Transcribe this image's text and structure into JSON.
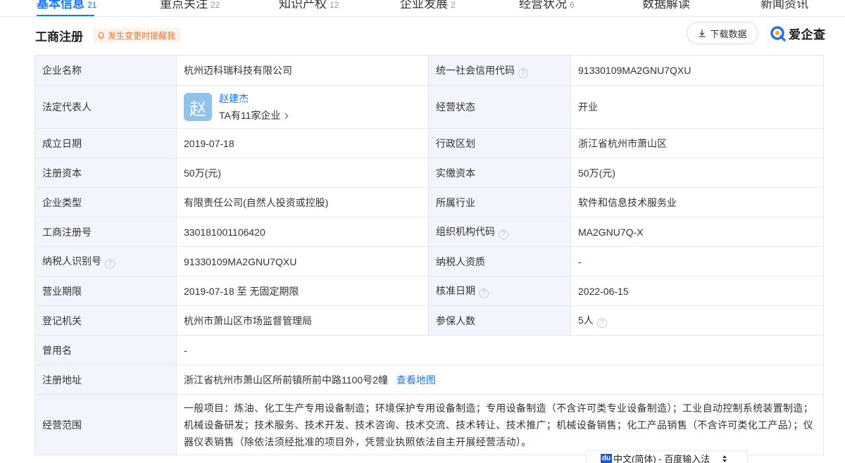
{
  "tabs": [
    {
      "label": "基本信息",
      "count": "21",
      "active": true
    },
    {
      "label": "重点关注",
      "count": "22"
    },
    {
      "label": "知识产权",
      "count": "12"
    },
    {
      "label": "企业发展",
      "count": "2"
    },
    {
      "label": "经营状况",
      "count": "6"
    },
    {
      "label": "数据解读",
      "count": ""
    },
    {
      "label": "新闻资讯",
      "count": ""
    }
  ],
  "section": {
    "title": "工商注册",
    "remind_label": "发生变更时提醒我",
    "download_label": "下载数据",
    "brand": "爱企查",
    "brand_color": "#2a6ff0"
  },
  "rows": {
    "company_name": {
      "label": "企业名称",
      "value": "杭州迈科瑞科技有限公司"
    },
    "credit_code": {
      "label": "统一社会信用代码",
      "value": "91330109MA2GNU7QXU"
    },
    "legal_rep": {
      "label": "法定代表人",
      "avatar": "赵",
      "name": "赵建杰",
      "sub": "TA有11家企业"
    },
    "status": {
      "label": "经营状态",
      "value": "开业"
    },
    "founded": {
      "label": "成立日期",
      "value": "2019-07-18"
    },
    "region": {
      "label": "行政区划",
      "value": "浙江省杭州市萧山区"
    },
    "reg_capital": {
      "label": "注册资本",
      "value": "50万(元)"
    },
    "paid_capital": {
      "label": "实缴资本",
      "value": "50万(元)"
    },
    "company_type": {
      "label": "企业类型",
      "value": "有限责任公司(自然人投资或控股)"
    },
    "industry": {
      "label": "所属行业",
      "value": "软件和信息技术服务业"
    },
    "reg_no": {
      "label": "工商注册号",
      "value": "330181001106420"
    },
    "org_code": {
      "label": "组织机构代码",
      "value": "MA2GNU7Q-X"
    },
    "tax_id": {
      "label": "纳税人识别号",
      "value": "91330109MA2GNU7QXU"
    },
    "taxpayer_quali": {
      "label": "纳税人资质",
      "value": "-"
    },
    "term": {
      "label": "营业期限",
      "value": "2019-07-18 至 无固定期限"
    },
    "approval_date": {
      "label": "核准日期",
      "value": "2022-06-15"
    },
    "authority": {
      "label": "登记机关",
      "value": "杭州市萧山区市场监督管理局"
    },
    "insured": {
      "label": "参保人数",
      "value": "5人"
    },
    "former_name": {
      "label": "曾用名",
      "value": "-"
    },
    "address": {
      "label": "注册地址",
      "value": "浙江省杭州市萧山区所前镇所前中路1100号2幢",
      "map_link": "查看地图"
    },
    "scope": {
      "label": "经营范围",
      "value": "一般项目：炼油、化工生产专用设备制造；环境保护专用设备制造；专用设备制造（不含许可类专业设备制造）；工业自动控制系统装置制造；机械设备研发；技术服务、技术开发、技术咨询、技术交流、技术转让、技术推广；机械设备销售；化工产品销售（不含许可类化工产品）；仪器仪表销售（除依法须经批准的项目外，凭营业执照依法自主开展经营活动）。"
    }
  },
  "ime": {
    "logo": "du",
    "text": "中文(简体) - 百度输入法"
  }
}
